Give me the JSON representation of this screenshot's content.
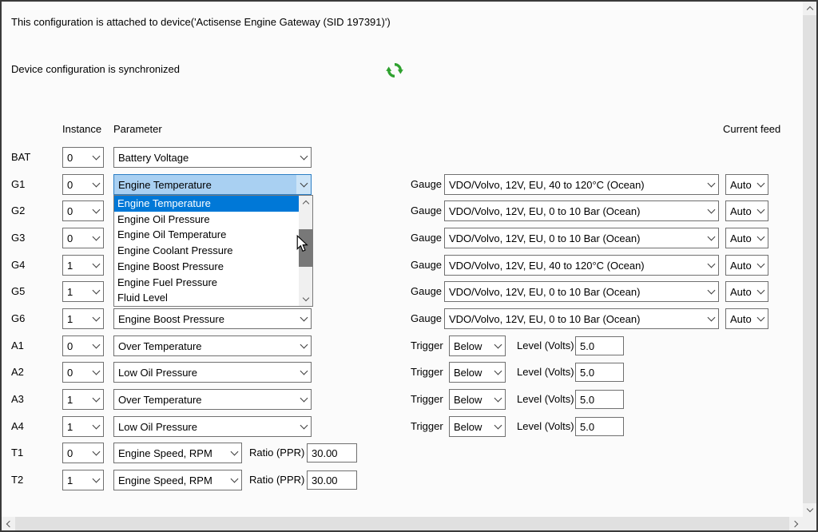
{
  "window": {
    "attached_text": "This configuration is attached to device('Actisense Engine Gateway (SID 197391)')",
    "sync_text": "Device configuration is synchronized",
    "accent_color": "#0078d7",
    "sync_icon_color": "#2fa12f"
  },
  "headers": {
    "instance": "Instance",
    "parameter": "Parameter",
    "current_feed": "Current feed"
  },
  "labels": {
    "gauge": "Gauge",
    "trigger": "Trigger",
    "level": "Level (Volts)",
    "ratio": "Ratio (PPR)"
  },
  "rows": {
    "bat": {
      "label": "BAT",
      "instance": "0",
      "parameter": "Battery Voltage"
    },
    "g1": {
      "label": "G1",
      "instance": "0",
      "parameter": "Engine Temperature",
      "gauge": "VDO/Volvo, 12V, EU, 40 to 120°C (Ocean)",
      "feed": "Auto"
    },
    "g2": {
      "label": "G2",
      "instance": "0",
      "gauge": "VDO/Volvo, 12V, EU, 0 to 10 Bar (Ocean)",
      "feed": "Auto"
    },
    "g3": {
      "label": "G3",
      "instance": "0",
      "gauge": "VDO/Volvo, 12V, EU, 0 to 10 Bar (Ocean)",
      "feed": "Auto"
    },
    "g4": {
      "label": "G4",
      "instance": "1",
      "gauge": "VDO/Volvo, 12V, EU, 40 to 120°C (Ocean)",
      "feed": "Auto"
    },
    "g5": {
      "label": "G5",
      "instance": "1",
      "gauge": "VDO/Volvo, 12V, EU, 0 to 10 Bar (Ocean)",
      "feed": "Auto"
    },
    "g6": {
      "label": "G6",
      "instance": "1",
      "parameter": "Engine Boost Pressure",
      "gauge": "VDO/Volvo, 12V, EU, 0 to 10 Bar (Ocean)",
      "feed": "Auto"
    },
    "a1": {
      "label": "A1",
      "instance": "0",
      "parameter": "Over Temperature",
      "trigger": "Below",
      "level": "5.0"
    },
    "a2": {
      "label": "A2",
      "instance": "0",
      "parameter": "Low Oil Pressure",
      "trigger": "Below",
      "level": "5.0"
    },
    "a3": {
      "label": "A3",
      "instance": "1",
      "parameter": "Over Temperature",
      "trigger": "Below",
      "level": "5.0"
    },
    "a4": {
      "label": "A4",
      "instance": "1",
      "parameter": "Low Oil Pressure",
      "trigger": "Below",
      "level": "5.0"
    },
    "t1": {
      "label": "T1",
      "instance": "0",
      "parameter": "Engine Speed, RPM",
      "ratio": "30.00"
    },
    "t2": {
      "label": "T2",
      "instance": "1",
      "parameter": "Engine Speed, RPM",
      "ratio": "30.00"
    }
  },
  "parameter_dropdown": {
    "items": [
      "Engine Temperature",
      "Engine Oil Pressure",
      "Engine Oil Temperature",
      "Engine Coolant Pressure",
      "Engine Boost Pressure",
      "Engine Fuel Pressure",
      "Fluid Level"
    ],
    "selected": "Engine Temperature"
  }
}
